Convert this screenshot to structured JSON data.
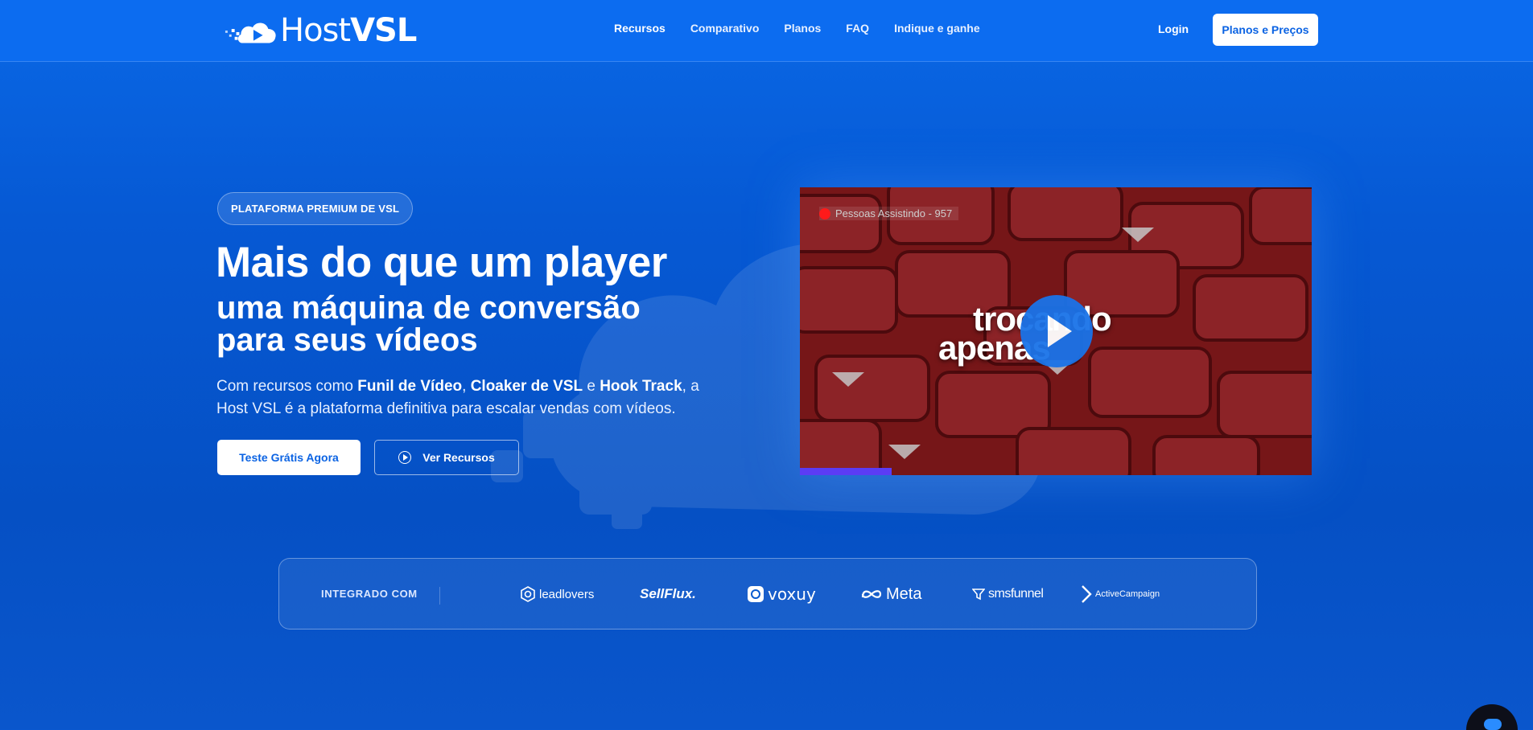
{
  "header": {
    "logo": {
      "light": "Host",
      "bold": "VSL"
    },
    "nav": [
      {
        "label": "Recursos",
        "active": true
      },
      {
        "label": "Comparativo",
        "active": false
      },
      {
        "label": "Planos",
        "active": false
      },
      {
        "label": "FAQ",
        "active": false
      },
      {
        "label": "Indique e ganhe",
        "active": false
      }
    ],
    "login": "Login",
    "cta": "Planos e Preços"
  },
  "hero": {
    "badge": "PLATAFORMA PREMIUM DE VSL",
    "title": "Mais do que um player",
    "subtitle_pre": "uma ",
    "subtitle_bold": "máquina de conversão",
    "subtitle_line2": "para seus vídeos",
    "lead": {
      "t1": "Com recursos como ",
      "b1": "Funil de Vídeo",
      "t2": ", ",
      "b2": "Cloaker de VSL",
      "t3": " e ",
      "b3": "Hook Track",
      "t4": ", a Host VSL é a plataforma definitiva para escalar vendas com vídeos."
    },
    "primary_button": "Teste Grátis Agora",
    "secondary_button": "Ver Recursos"
  },
  "video": {
    "viewers": "Pessoas Assistindo - 957",
    "caption_line1": "trocando",
    "caption_line2": "apenas",
    "progress": 0.18,
    "colors": {
      "progress": "#5b3cf5",
      "play": "#1a73e8",
      "dot": "#ff1a1a"
    }
  },
  "integrations": {
    "label": "INTEGRADO COM",
    "brands": [
      "leadlovers",
      "SellFlux.",
      "voxuy",
      "Meta",
      "smsfunnel",
      "ActiveCampaign"
    ]
  },
  "colors": {
    "bg_top": "#0a68e6",
    "bg_bottom": "#0550c4",
    "accent": "#0b63e3"
  }
}
